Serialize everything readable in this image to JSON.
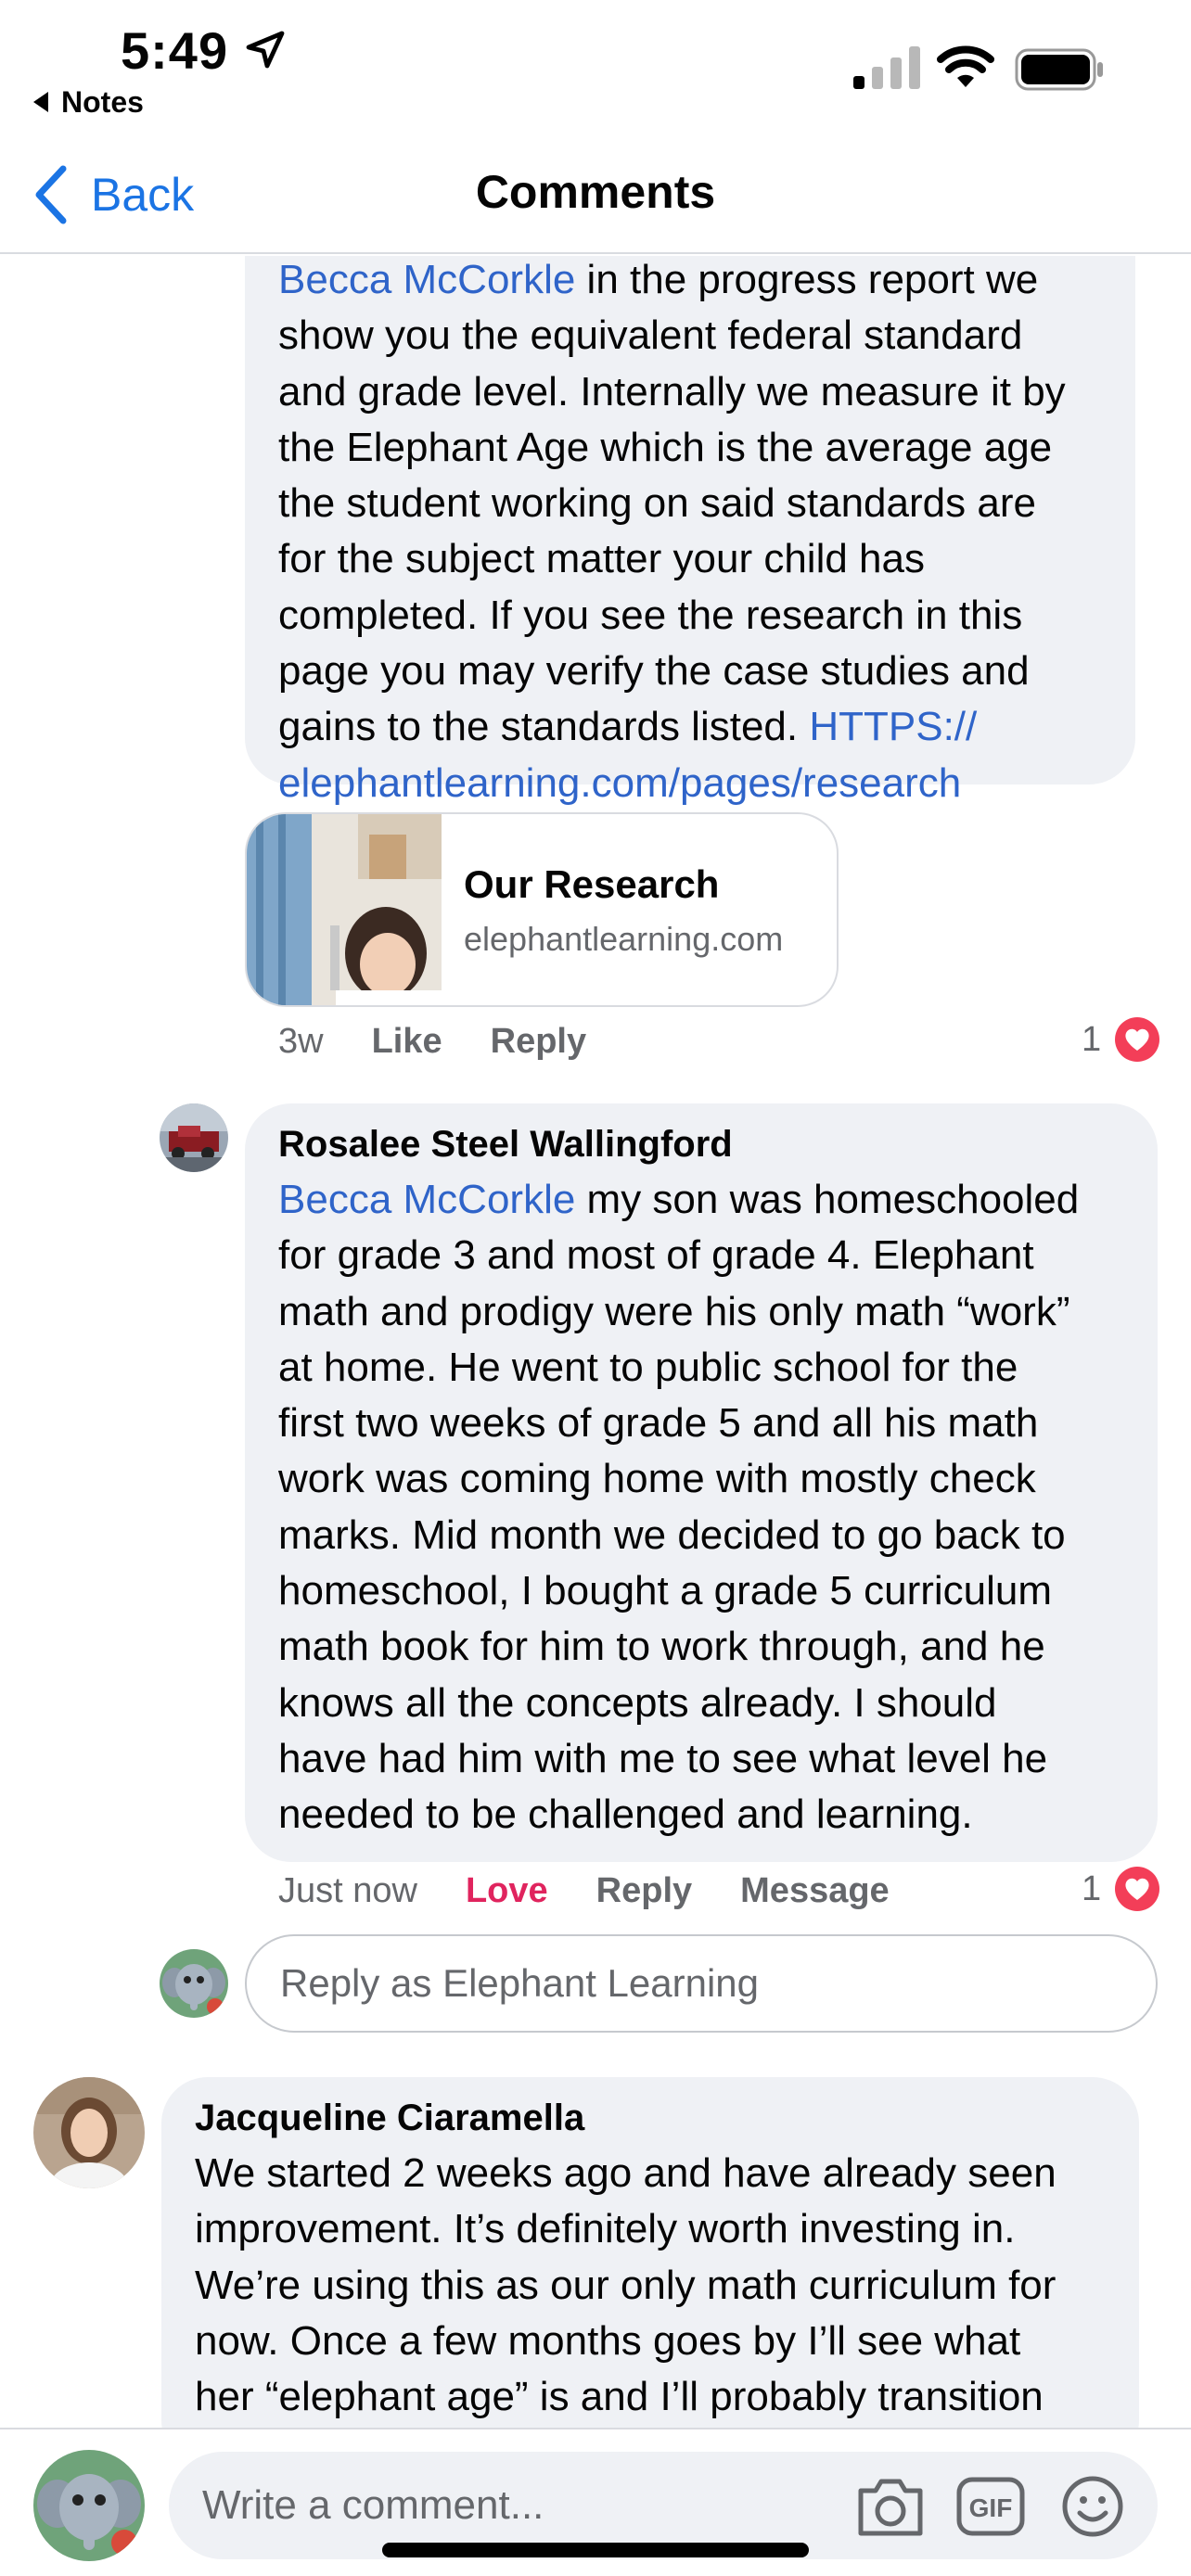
{
  "status_bar": {
    "time": "5:49",
    "back_app": "Notes"
  },
  "nav": {
    "back_label": "Back",
    "title": "Comments"
  },
  "comment1": {
    "lines": [
      {
        "mention": "Becca McCorkle",
        "text": " in the progress report we"
      },
      {
        "text": "show you the equivalent federal standard"
      },
      {
        "text": "and grade level. Internally we measure it by"
      },
      {
        "text": "the Elephant Age which is the average age"
      },
      {
        "text": "the student working on said standards are"
      },
      {
        "text": "for the subject matter your child has"
      },
      {
        "text": "completed. If you see the research in this"
      },
      {
        "text": "page you may verify the case studies and"
      },
      {
        "text": "gains to the standards listed. ",
        "link": "HTTPS://"
      },
      {
        "link": "elephantlearning.com/pages/research"
      }
    ],
    "preview_title": "Our Research",
    "preview_domain": "elephantlearning.com",
    "timestamp": "3w",
    "like_label": "Like",
    "reply_label": "Reply",
    "reaction_count": "1"
  },
  "comment2": {
    "author": "Rosalee Steel Wallingford",
    "lines": [
      {
        "mention": "Becca McCorkle",
        "text": " my son was homeschooled"
      },
      {
        "text": "for grade 3 and most of grade 4. Elephant"
      },
      {
        "text": "math and prodigy were his only math “work”"
      },
      {
        "text": "at home.  He went to public school for the"
      },
      {
        "text": "first two weeks of grade 5 and all his math"
      },
      {
        "text": "work was coming home with mostly check"
      },
      {
        "text": "marks.  Mid month we decided to go back to"
      },
      {
        "text": "homeschool, I bought a grade 5 curriculum"
      },
      {
        "text": "math book for him to work through, and he"
      },
      {
        "text": "knows all the concepts already. I should"
      },
      {
        "text": "have had him with me to see what level he"
      },
      {
        "text": "needed to be challenged and learning."
      }
    ],
    "timestamp": "Just now",
    "love_label": "Love",
    "reply_label": "Reply",
    "message_label": "Message",
    "reaction_count": "1"
  },
  "reply_box": {
    "placeholder": "Reply as Elephant Learning"
  },
  "comment3": {
    "author": "Jacqueline Ciaramella",
    "lines": [
      {
        "text": "We started 2 weeks ago and have already seen"
      },
      {
        "text": "improvement. It’s definitely worth investing in."
      },
      {
        "text": "We’re using this as our only math curriculum for"
      },
      {
        "text": "now. Once a few months goes by I’ll see what"
      },
      {
        "text": "her “elephant age” is and I’ll probably transition"
      }
    ]
  },
  "composer": {
    "placeholder": "Write a comment...",
    "icons": [
      "camera-icon",
      "gif-icon",
      "emoji-icon"
    ]
  },
  "colors": {
    "accent": "#1b74e4",
    "mention": "#2f64c9",
    "love": "#e0245e",
    "bubble": "#eff1f5",
    "secondary_text": "#65676b"
  }
}
